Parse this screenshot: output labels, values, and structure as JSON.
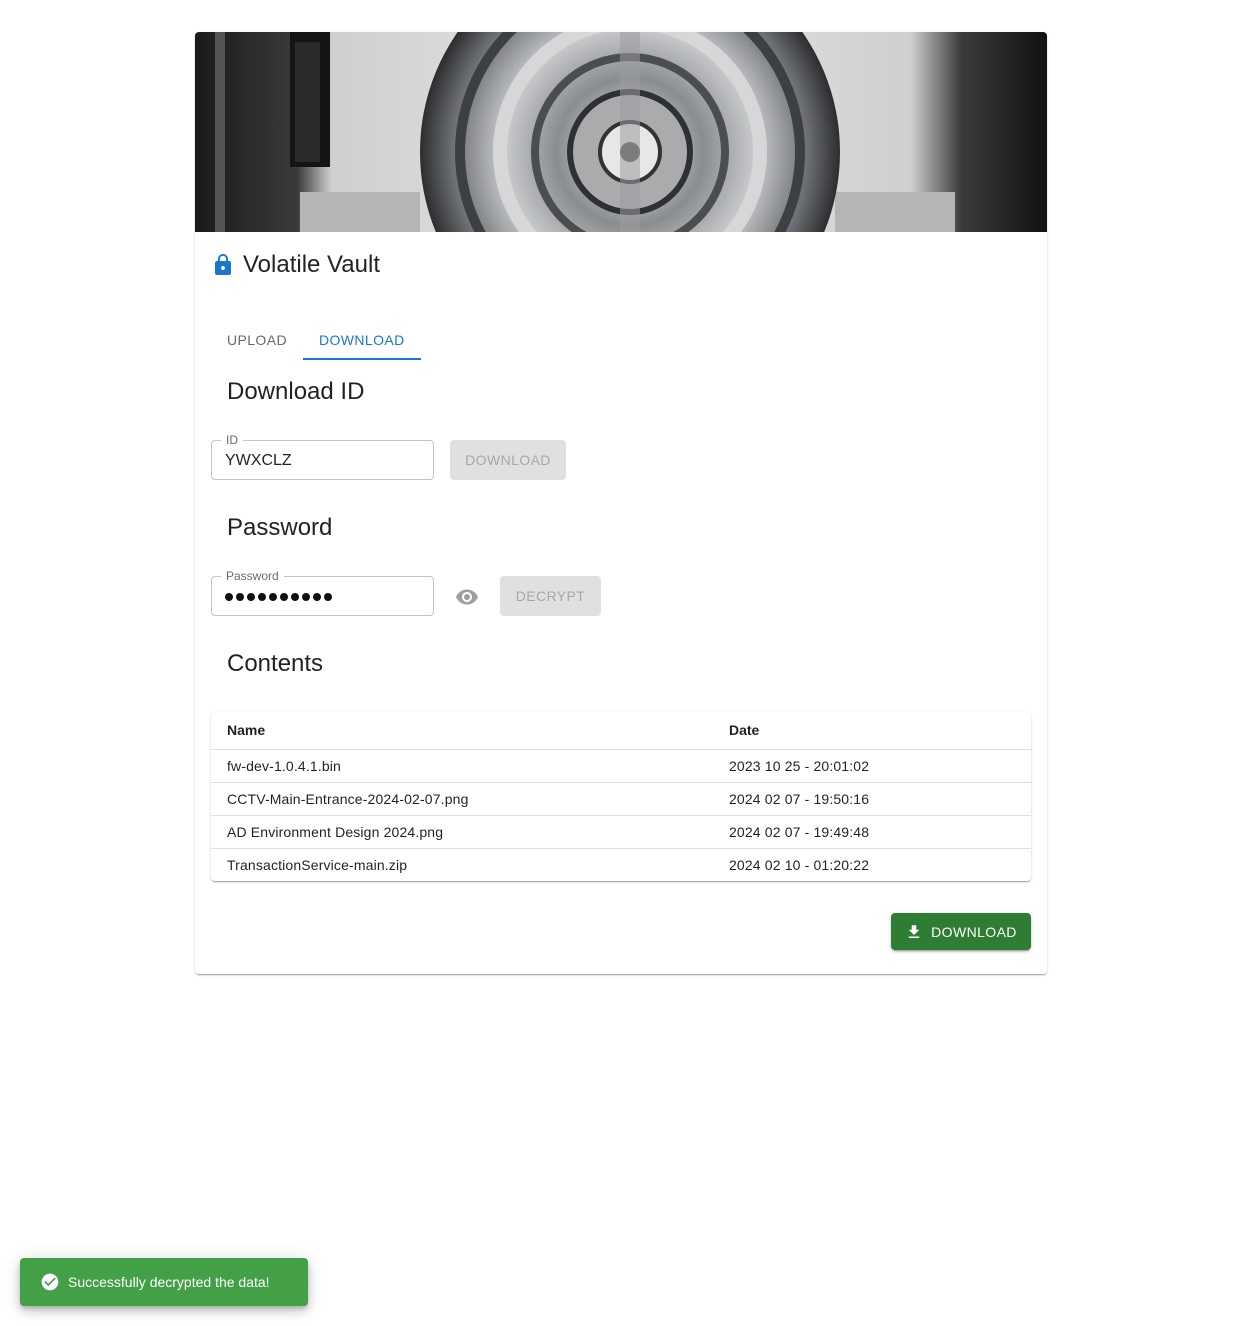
{
  "app": {
    "title": "Volatile Vault",
    "accent": "#1976d2"
  },
  "tabs": [
    {
      "label": "UPLOAD",
      "active": false
    },
    {
      "label": "DOWNLOAD",
      "active": true
    }
  ],
  "download_section": {
    "heading": "Download ID",
    "id_label": "ID",
    "id_value": "YWXCLZ",
    "button_label": "DOWNLOAD",
    "button_disabled": true
  },
  "password_section": {
    "heading": "Password",
    "field_label": "Password",
    "masked_length": 10,
    "visibility_icon": "eye-icon",
    "button_label": "DECRYPT",
    "button_disabled": true
  },
  "contents": {
    "heading": "Contents",
    "columns": [
      "Name",
      "Date"
    ],
    "rows": [
      {
        "name": "fw-dev-1.0.4.1.bin",
        "date": "2023 10 25 - 20:01:02"
      },
      {
        "name": "CCTV-Main-Entrance-2024-02-07.png",
        "date": "2024 02 07 - 19:50:16"
      },
      {
        "name": "AD Environment Design 2024.png",
        "date": "2024 02 07 - 19:49:48"
      },
      {
        "name": "TransactionService-main.zip",
        "date": "2024 02 10 - 01:20:22"
      }
    ],
    "download_button_label": "DOWNLOAD",
    "download_button_color": "#2e7d32"
  },
  "snackbar": {
    "message": "Successfully decrypted the data!",
    "color": "#43a047",
    "icon": "check-circle-icon"
  }
}
